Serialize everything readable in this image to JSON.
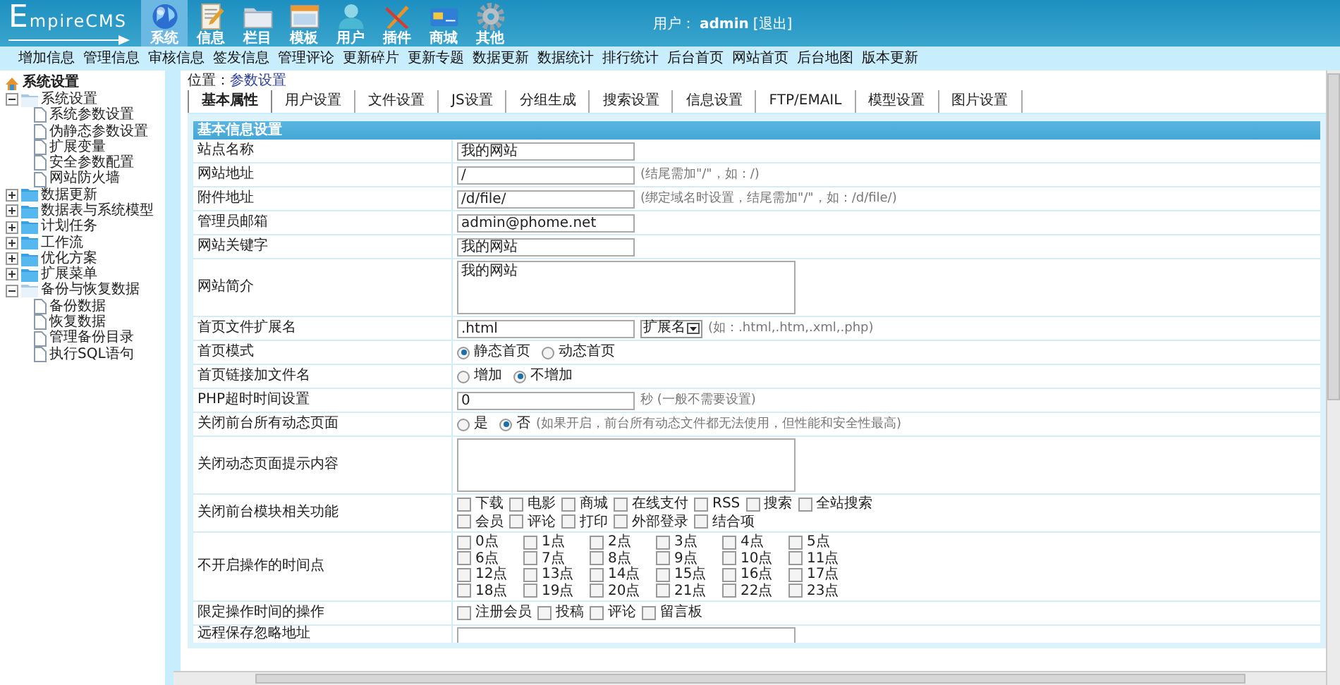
{
  "header": {
    "logo": "EmpireCMS",
    "nav": [
      {
        "label": "系统",
        "kind": "globe",
        "selected": true
      },
      {
        "label": "信息",
        "kind": "document",
        "selected": false
      },
      {
        "label": "栏目",
        "kind": "folder",
        "selected": false
      },
      {
        "label": "模板",
        "kind": "window",
        "selected": false
      },
      {
        "label": "用户",
        "kind": "user",
        "selected": false
      },
      {
        "label": "插件",
        "kind": "tools",
        "selected": false
      },
      {
        "label": "商城",
        "kind": "card",
        "selected": false
      },
      {
        "label": "其他",
        "kind": "gear",
        "selected": false
      }
    ],
    "user": {
      "label": "用户：",
      "name": "admin",
      "logout": "[退出]"
    }
  },
  "subnav": [
    "增加信息",
    "管理信息",
    "审核信息",
    "签发信息",
    "管理评论",
    "更新碎片",
    "更新专题",
    "数据更新",
    "数据统计",
    "排行统计",
    "后台首页",
    "网站首页",
    "后台地图",
    "版本更新"
  ],
  "sidebar": {
    "title": "系统设置",
    "tree": [
      {
        "label": "系统设置",
        "kind": "folder",
        "expanded": true,
        "children": [
          {
            "label": "系统参数设置",
            "kind": "page"
          },
          {
            "label": "伪静态参数设置",
            "kind": "page"
          },
          {
            "label": "扩展变量",
            "kind": "page"
          },
          {
            "label": "安全参数配置",
            "kind": "page"
          },
          {
            "label": "网站防火墙",
            "kind": "page"
          }
        ]
      },
      {
        "label": "数据更新",
        "kind": "folder",
        "expanded": false
      },
      {
        "label": "数据表与系统模型",
        "kind": "folder",
        "expanded": false
      },
      {
        "label": "计划任务",
        "kind": "folder",
        "expanded": false
      },
      {
        "label": "工作流",
        "kind": "folder",
        "expanded": false
      },
      {
        "label": "优化方案",
        "kind": "folder",
        "expanded": false
      },
      {
        "label": "扩展菜单",
        "kind": "folder",
        "expanded": false
      },
      {
        "label": "备份与恢复数据",
        "kind": "folder",
        "expanded": true,
        "children": [
          {
            "label": "备份数据",
            "kind": "page"
          },
          {
            "label": "恢复数据",
            "kind": "page"
          },
          {
            "label": "管理备份目录",
            "kind": "page"
          },
          {
            "label": "执行SQL语句",
            "kind": "page"
          }
        ]
      }
    ]
  },
  "breadcrumb": {
    "label": "位置：",
    "link": "参数设置"
  },
  "tabs": [
    {
      "label": "基本属性",
      "selected": true
    },
    {
      "label": "用户设置",
      "selected": false
    },
    {
      "label": "文件设置",
      "selected": false
    },
    {
      "label": "JS设置",
      "selected": false
    },
    {
      "label": "分组生成",
      "selected": false
    },
    {
      "label": "搜索设置",
      "selected": false
    },
    {
      "label": "信息设置",
      "selected": false
    },
    {
      "label": "FTP/EMAIL",
      "selected": false
    },
    {
      "label": "模型设置",
      "selected": false
    },
    {
      "label": "图片设置",
      "selected": false
    }
  ],
  "section_title": "基本信息设置",
  "rows": [
    {
      "label": "站点名称",
      "kind": "text",
      "value": "我的网站"
    },
    {
      "label": "网站地址",
      "kind": "text",
      "value": "/",
      "hint": "(结尾需加\"/\"，如：/)"
    },
    {
      "label": "附件地址",
      "kind": "text",
      "value": "/d/file/",
      "hint": "(绑定域名时设置，结尾需加\"/\"，如：/d/file/)"
    },
    {
      "label": "管理员邮箱",
      "kind": "text",
      "value": "admin@phome.net"
    },
    {
      "label": "网站关键字",
      "kind": "text",
      "value": "我的网站"
    },
    {
      "label": "网站简介",
      "kind": "textarea",
      "value": "我的网站"
    },
    {
      "label": "首页文件扩展名",
      "kind": "text_select",
      "value": ".html",
      "select": "扩展名",
      "hint": "(如：.html,.htm,.xml,.php)"
    },
    {
      "label": "首页模式",
      "kind": "radio",
      "options": [
        {
          "label": "静态首页",
          "selected": true
        },
        {
          "label": "动态首页",
          "selected": false
        }
      ]
    },
    {
      "label": "首页链接加文件名",
      "kind": "radio",
      "options": [
        {
          "label": "增加",
          "selected": false
        },
        {
          "label": "不增加",
          "selected": true
        }
      ]
    },
    {
      "label": "PHP超时时间设置",
      "kind": "text",
      "value": "0",
      "hint": "秒 (一般不需要设置)"
    },
    {
      "label": "关闭前台所有动态页面",
      "kind": "radio",
      "options": [
        {
          "label": "是",
          "selected": false
        },
        {
          "label": "否",
          "selected": true
        }
      ],
      "hint": "(如果开启，前台所有动态文件都无法使用，但性能和安全性最高)"
    },
    {
      "label": "关闭动态页面提示内容",
      "kind": "textarea"
    },
    {
      "label": "关闭前台模块相关功能",
      "kind": "checks",
      "lines": [
        [
          {
            "label": "下载",
            "checked": false
          },
          {
            "label": "电影",
            "checked": false
          },
          {
            "label": "商城",
            "checked": false
          },
          {
            "label": "在线支付",
            "checked": false
          },
          {
            "label": "RSS",
            "checked": false
          },
          {
            "label": "搜索",
            "checked": false
          },
          {
            "label": "全站搜索",
            "checked": false
          }
        ],
        [
          {
            "label": "会员",
            "checked": false
          },
          {
            "label": "评论",
            "checked": false
          },
          {
            "label": "打印",
            "checked": false
          },
          {
            "label": "外部登录",
            "checked": false
          },
          {
            "label": "结合项",
            "checked": false
          }
        ]
      ]
    },
    {
      "label": "不开启操作的时间点",
      "kind": "hours",
      "options": [
        {
          "label": "0点",
          "checked": false
        },
        {
          "label": "1点",
          "checked": false
        },
        {
          "label": "2点",
          "checked": false
        },
        {
          "label": "3点",
          "checked": false
        },
        {
          "label": "4点",
          "checked": false
        },
        {
          "label": "5点",
          "checked": false
        },
        {
          "label": "6点",
          "checked": false
        },
        {
          "label": "7点",
          "checked": false
        },
        {
          "label": "8点",
          "checked": false
        },
        {
          "label": "9点",
          "checked": false
        },
        {
          "label": "10点",
          "checked": false
        },
        {
          "label": "11点",
          "checked": false
        },
        {
          "label": "12点",
          "checked": false
        },
        {
          "label": "13点",
          "checked": false
        },
        {
          "label": "14点",
          "checked": false
        },
        {
          "label": "15点",
          "checked": false
        },
        {
          "label": "16点",
          "checked": false
        },
        {
          "label": "17点",
          "checked": false
        },
        {
          "label": "18点",
          "checked": false
        },
        {
          "label": "19点",
          "checked": false
        },
        {
          "label": "20点",
          "checked": false
        },
        {
          "label": "21点",
          "checked": false
        },
        {
          "label": "22点",
          "checked": false
        },
        {
          "label": "23点",
          "checked": false
        }
      ]
    },
    {
      "label": "限定操作时间的操作",
      "kind": "checks",
      "lines": [
        [
          {
            "label": "注册会员",
            "checked": false
          },
          {
            "label": "投稿",
            "checked": false
          },
          {
            "label": "评论",
            "checked": false
          },
          {
            "label": "留言板",
            "checked": false
          }
        ]
      ]
    },
    {
      "label": "远程保存忽略地址",
      "kind": "textarea_cut"
    }
  ]
}
